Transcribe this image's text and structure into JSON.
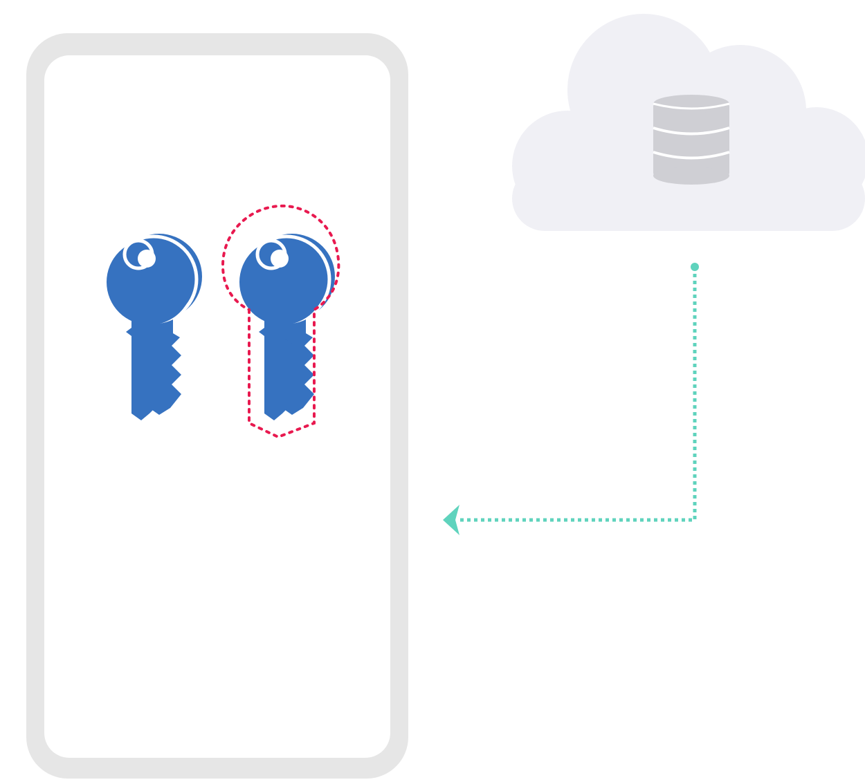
{
  "diagram": {
    "phone": {
      "icon": "phone-device-icon",
      "frame_color": "#e6e6e6",
      "screen_color": "#ffffff"
    },
    "keys": [
      {
        "icon": "key-icon",
        "color": "#3672c0",
        "highlighted": false
      },
      {
        "icon": "key-icon",
        "color": "#3672c0",
        "highlighted": true,
        "highlight_color": "#e8194f"
      }
    ],
    "cloud": {
      "icon": "cloud-icon",
      "color": "#f0f0f5",
      "contents": {
        "icon": "database-icon",
        "color": "#cfcfd4"
      }
    },
    "connector": {
      "icon": "arrow-left-icon",
      "style": "dotted",
      "color": "#5fd3bd",
      "from": "cloud",
      "to": "phone"
    }
  }
}
